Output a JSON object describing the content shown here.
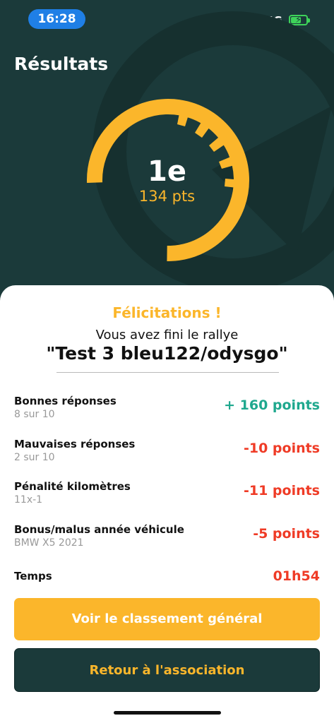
{
  "status_bar": {
    "time": "16:28",
    "network": "4G",
    "icons": [
      "signal-icon",
      "battery-charging-icon"
    ]
  },
  "header": {
    "title": "Résultats"
  },
  "result": {
    "rank": "1e",
    "points": "134 pts"
  },
  "card": {
    "congrats": "Félicitations !",
    "subtitle": "Vous avez fini le rallye",
    "rally_name": "\"Test 3 bleu122/odysgo\"",
    "rows": [
      {
        "label": "Bonnes réponses",
        "sub": "8 sur 10",
        "value": "+ 160 points"
      },
      {
        "label": "Mauvaises réponses",
        "sub": "2 sur 10",
        "value": "-10 points"
      },
      {
        "label": "Pénalité kilomètres",
        "sub": "11x-1",
        "value": "-11 points"
      },
      {
        "label": "Bonus/malus année véhicule",
        "sub": "BMW X5 2021",
        "value": "-5 points"
      },
      {
        "label": "Temps",
        "sub": "",
        "value": "01h54"
      }
    ]
  },
  "buttons": {
    "ranking": "Voir le classement général",
    "back": "Retour à l'association"
  },
  "colors": {
    "background": "#1b3a3a",
    "accent": "#fbb62b",
    "positive": "#1fa88e",
    "negative": "#ef3b26"
  }
}
